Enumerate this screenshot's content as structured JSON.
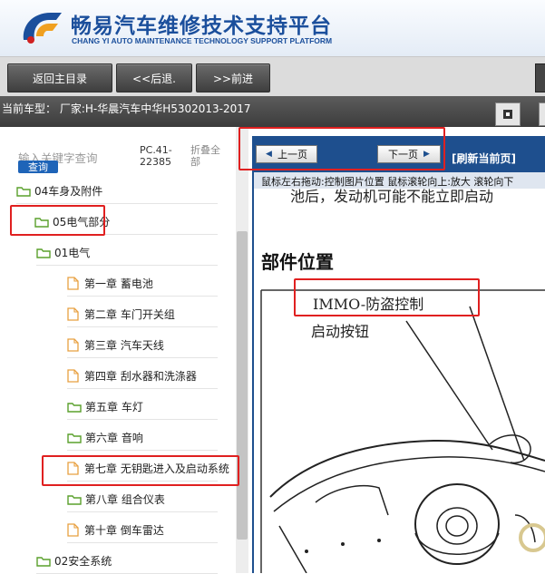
{
  "header": {
    "title_cn": "畅易汽车维修技术支持平台",
    "title_en": "CHANG YI AUTO MAINTENANCE TECHNOLOGY SUPPORT PLATFORM"
  },
  "toolbar": {
    "home_label": "返回主目录",
    "back_label": "<<后退.",
    "forward_label": ">>前进"
  },
  "model_bar": {
    "text": "当前车型： 厂家:H-华晨汽车中华H5302013-2017"
  },
  "search": {
    "placeholder": "输入关键字查询",
    "button_label": "查询",
    "pc_label": "PC.41-22385",
    "collapse_label": "折叠全部"
  },
  "tree": {
    "items": [
      {
        "label": "04车身及附件",
        "type": "folder"
      },
      {
        "label": "05电气部分",
        "type": "folder"
      },
      {
        "label": "01电气",
        "type": "folder"
      },
      {
        "label": "第一章 蓄电池",
        "type": "doc"
      },
      {
        "label": "第二章 车门开关组",
        "type": "doc"
      },
      {
        "label": "第三章 汽车天线",
        "type": "doc"
      },
      {
        "label": "第四章 刮水器和洗涤器",
        "type": "doc"
      },
      {
        "label": "第五章 车灯",
        "type": "folder"
      },
      {
        "label": "第六章 音响",
        "type": "folder"
      },
      {
        "label": "第七章 无钥匙进入及启动系统",
        "type": "doc"
      },
      {
        "label": "第八章 组合仪表",
        "type": "folder"
      },
      {
        "label": "第十章 倒车雷达",
        "type": "doc"
      },
      {
        "label": "02安全系统",
        "type": "folder"
      }
    ]
  },
  "doc_nav": {
    "prev_label": "上一页",
    "next_label": "下一页",
    "refresh_label": "[刷新当前页]",
    "hint": "鼠标左右拖动:控制图片位置 鼠标滚轮向上:放大  滚轮向下"
  },
  "document": {
    "top_text": "池后，发动机可能不能立即启动",
    "heading": "部件位置",
    "label_immo": "IMMO-防盗控制",
    "label_start": "启动按钮"
  },
  "colors": {
    "brand_blue": "#1b4f9c",
    "nav_blue": "#1e4f8e",
    "highlight_red": "#e02020",
    "folder_green": "#5aa02c",
    "doc_orange": "#e8a040"
  }
}
